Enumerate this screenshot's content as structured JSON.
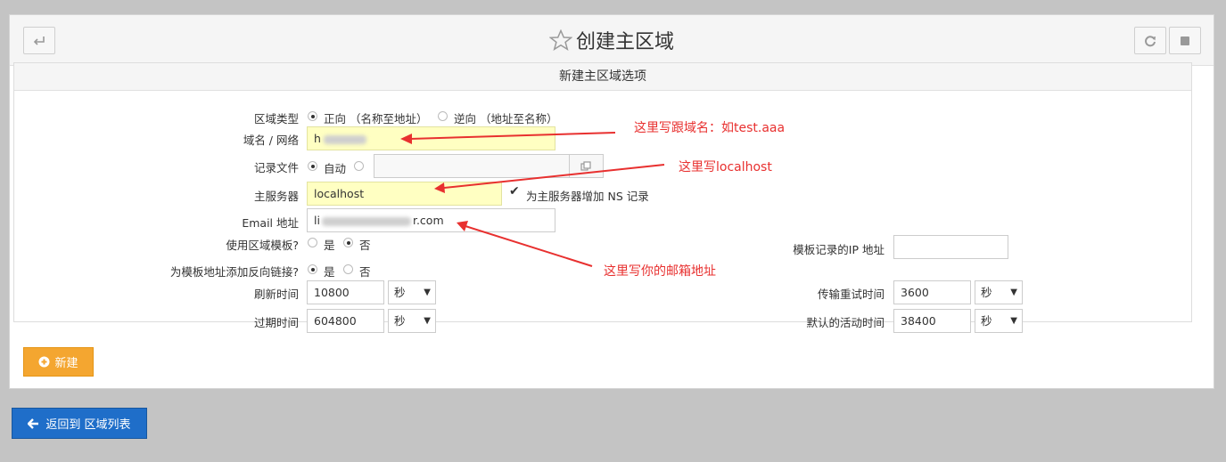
{
  "header": {
    "title": "创建主区域",
    "back_icon": "return-icon",
    "refresh_icon": "refresh-icon",
    "stop_icon": "stop-icon",
    "star_icon": "star-icon"
  },
  "section_title": "新建主区域选项",
  "form": {
    "zone_type": {
      "label": "区域类型",
      "options": [
        "正向 （名称至地址）",
        "逆向 （地址至名称）"
      ],
      "selected": "正向 （名称至地址）"
    },
    "domain": {
      "label": "域名 / 网络",
      "value": "h"
    },
    "record_file": {
      "label": "记录文件",
      "options": [
        "自动",
        ""
      ],
      "selected": "自动",
      "value": ""
    },
    "master_server": {
      "label": "主服务器",
      "value": "localhost",
      "add_ns_label": "为主服务器增加 NS 记录",
      "add_ns_checked": true
    },
    "email": {
      "label": "Email 地址",
      "value_prefix": "li",
      "value_suffix": "r.com"
    },
    "use_template": {
      "label": "使用区域模板?",
      "options": [
        "是",
        "否"
      ],
      "selected": "否"
    },
    "template_ip": {
      "label": "模板记录的IP 地址",
      "value": ""
    },
    "add_reverse": {
      "label": "为模板地址添加反向链接?",
      "options": [
        "是",
        "否"
      ],
      "selected": "是"
    },
    "refresh": {
      "label": "刷新时间",
      "value": "10800",
      "unit": "秒"
    },
    "transfer_retry": {
      "label": "传输重试时间",
      "value": "3600",
      "unit": "秒"
    },
    "expire": {
      "label": "过期时间",
      "value": "604800",
      "unit": "秒"
    },
    "default_ttl": {
      "label": "默认的活动时间",
      "value": "38400",
      "unit": "秒"
    }
  },
  "annotations": {
    "domain_note": "这里写跟域名：如test.aaa",
    "server_note": "这里写localhost",
    "email_note": "这里写你的邮箱地址",
    "color": "#e8302f"
  },
  "buttons": {
    "create": "新建",
    "return": "返回到 区域列表"
  }
}
